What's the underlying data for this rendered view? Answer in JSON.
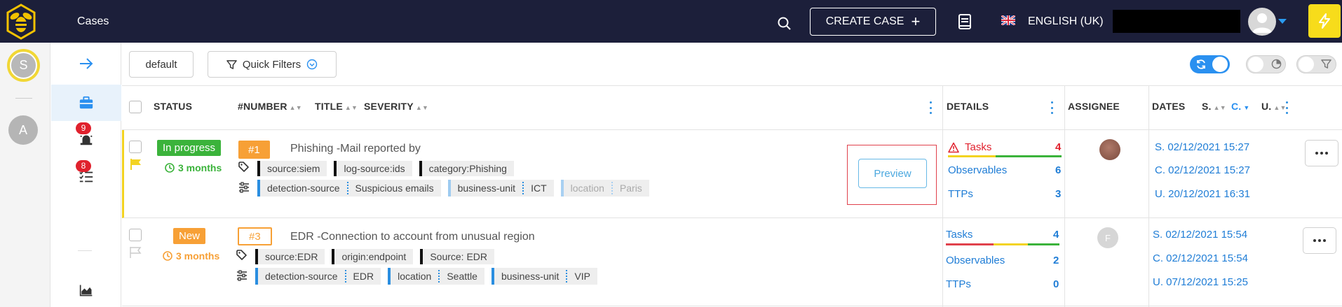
{
  "header": {
    "app_title": "Cases",
    "create_case_label": "CREATE CASE",
    "create_case_plus": "+",
    "language": "ENGLISH (UK)"
  },
  "rail": {
    "org_initial": "S",
    "other_org_initial": "A"
  },
  "nav": {
    "alerts_badge": "9",
    "tasks_badge": "8"
  },
  "toolbar": {
    "default_label": "default",
    "quick_filters_label": "Quick Filters",
    "toggles": [
      {
        "name": "auto-refresh",
        "on": true
      },
      {
        "name": "stats",
        "on": false
      },
      {
        "name": "filters",
        "on": false
      }
    ]
  },
  "table": {
    "columns": {
      "status": "STATUS",
      "number": "#NUMBER",
      "title": "TITLE",
      "severity": "SEVERITY",
      "details": "DETAILS",
      "assignee": "ASSIGNEE",
      "dates": "DATES",
      "dates_s": "S.",
      "dates_c": "C.",
      "dates_u": "U."
    },
    "rows": [
      {
        "status": "In progress",
        "status_color": "#3bb33b",
        "age": "3 months",
        "age_color": "#3bb33b",
        "number": "#1",
        "number_style": "filled",
        "title": "Phishing -Mail reported by",
        "tags": [
          "source:siem",
          "log-source:ids",
          "category:Phishing"
        ],
        "custom_fields": [
          {
            "name": "detection-source",
            "value": "Suspicious emails"
          },
          {
            "name": "business-unit",
            "value": "ICT"
          },
          {
            "name": "location",
            "value": "Paris"
          }
        ],
        "preview_label": "Preview",
        "details": {
          "tasks_label": "Tasks",
          "tasks_count": "4",
          "observables_label": "Observables",
          "observables_count": "6",
          "ttps_label": "TTPs",
          "ttps_count": "3"
        },
        "dates": {
          "s": "S. 02/12/2021 15:27",
          "c": "C. 02/12/2021 15:27",
          "u": "U. 20/12/2021 16:31"
        }
      },
      {
        "status": "New",
        "status_color": "#f7a036",
        "age": "3 months",
        "age_color": "#f7a036",
        "number": "#3",
        "number_style": "outlined",
        "title": "EDR -Connection to account from unusual region",
        "tags": [
          "source:EDR",
          "origin:endpoint",
          "Source: EDR"
        ],
        "custom_fields": [
          {
            "name": "detection-source",
            "value": "EDR"
          },
          {
            "name": "location",
            "value": "Seattle"
          },
          {
            "name": "business-unit",
            "value": "VIP"
          }
        ],
        "assignee_initial": "F",
        "details": {
          "tasks_label": "Tasks",
          "tasks_count": "4",
          "observables_label": "Observables",
          "observables_count": "2",
          "ttps_label": "TTPs",
          "ttps_count": "0"
        },
        "dates": {
          "s": "S. 02/12/2021 15:54",
          "c": "C. 02/12/2021 15:54",
          "u": "U. 07/12/2021 15:25"
        }
      }
    ]
  },
  "colors": {
    "topbar": "#1c1f3a",
    "accent": "#2a90f0",
    "danger": "#e0212d",
    "warning": "#f7a036",
    "success": "#3bb33b",
    "bolt": "#f7dc1b"
  }
}
